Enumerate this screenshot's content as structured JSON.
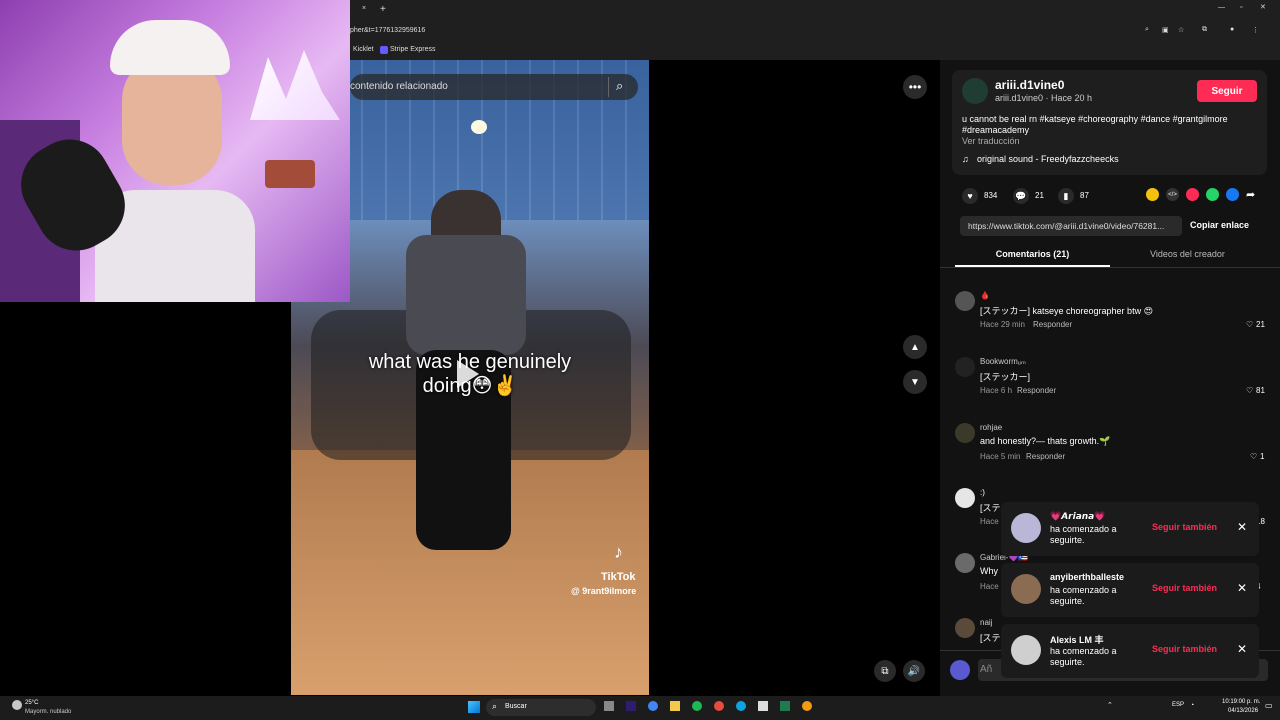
{
  "browser": {
    "tab_new": "+",
    "tab_close": "×",
    "url": "pher&t=1776132959616",
    "bookmarks": [
      "Kicklet",
      "Stripe Express"
    ]
  },
  "video": {
    "search_placeholder": "contenido relacionado",
    "caption_line1": "what was he genuinely",
    "caption_line2": "doing😳✌️",
    "watermark_brand": "TikTok",
    "watermark_user": "@ 9rant9ilmore"
  },
  "post": {
    "username": "ariii.d1vine0",
    "subline": "ariii.d1vine0 · Hace 20 h",
    "follow_label": "Seguir",
    "description_line1": "u cannot be real rn #katseye #choreography #dance #grantgilmore",
    "description_line2": "#dreamacademy",
    "translate": "Ver traducción",
    "sound": "original sound - Freedyfazzcheecks",
    "likes": "834",
    "comments": "21",
    "saves": "87",
    "link": "https://www.tiktok.com/@ariii.d1vine0/video/76281...",
    "copy_link": "Copiar enlace",
    "tab_comments": "Comentarios (21)",
    "tab_creator": "Videos del creador"
  },
  "comments": [
    {
      "user": "🩸",
      "text": "[ステッカー] katseye choreographer btw 😍",
      "time": "Hace 29 min",
      "reply": "Responder",
      "likes": "21"
    },
    {
      "user": "Bookwormᵤₘ",
      "text": "[ステッカー]",
      "time": "Hace 6 h",
      "reply": "Responder",
      "likes": "81"
    },
    {
      "user": "rohjae",
      "text": "and honestly?— thats growth.🌱",
      "time": "Hace 5 min",
      "reply": "Responder",
      "likes": "1"
    },
    {
      "user": ":)",
      "text": "[ステ",
      "time": "Hace",
      "reply": "",
      "likes": "18"
    },
    {
      "user": "Gabriel-💜🇵🇷",
      "text": "Why",
      "time": "Hace",
      "reply": "",
      "likes": "4"
    },
    {
      "user": "naij",
      "text": "[ステ",
      "time": "",
      "reply": "",
      "likes": ""
    }
  ],
  "comment_input_placeholder": "Añ",
  "notifications": [
    {
      "name": "💗𝘼𝙧𝙞𝙖𝙣𝙖💗",
      "msg": "ha comenzado a seguirte.",
      "follow": "Seguir también"
    },
    {
      "name": "anyiberthballeste",
      "msg": "ha comenzado a seguirte.",
      "follow": "Seguir también"
    },
    {
      "name": "Alexis LM 丰",
      "msg": "ha comenzado a seguirte.",
      "follow": "Seguir también"
    }
  ],
  "taskbar": {
    "weather_temp": "25°C",
    "weather_desc": "Mayorm. nublado",
    "search": "Buscar",
    "lang": "ESP",
    "time": "10:19:00 p. m.",
    "date": "04/13/2026"
  },
  "colors": {
    "accent": "#fe2c55",
    "panel_bg": "#121212"
  }
}
